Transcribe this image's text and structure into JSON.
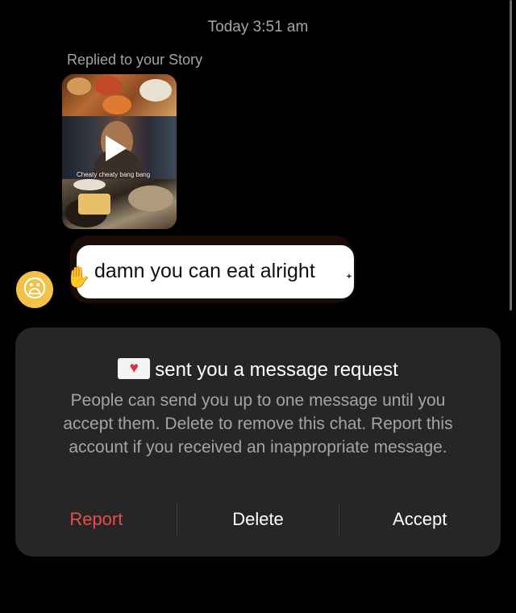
{
  "conversation": {
    "timestamp": "Today 3:51 am",
    "replied_label": "Replied to your Story",
    "story": {
      "caption": "Cheaty cheaty bang bang"
    },
    "message_text": "damn you can eat alright"
  },
  "request_panel": {
    "title": "sent you a message request",
    "description": "People can send you up to one message until you accept them. Delete to remove this chat. Report this account if you received an inappropriate message.",
    "actions": {
      "report": "Report",
      "delete": "Delete",
      "accept": "Accept"
    }
  },
  "icons": {
    "avatar": "surprised-face-emoji",
    "envelope": "love-letter-emoji",
    "play": "play-icon"
  },
  "colors": {
    "report": "#ea4b4b",
    "panel_bg": "#262626"
  }
}
